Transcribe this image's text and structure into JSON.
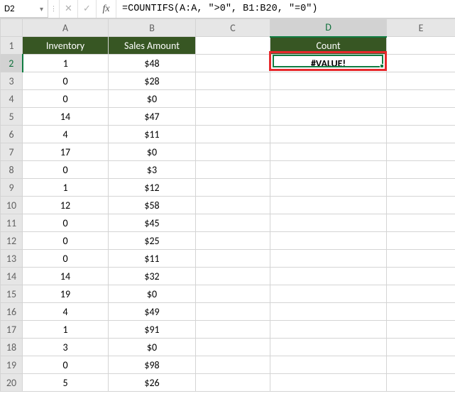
{
  "name_box": "D2",
  "formula": "=COUNTIFS(A:A, \">0\", B1:B20, \"=0\")",
  "fx_label": "fx",
  "columns": [
    "A",
    "B",
    "C",
    "D",
    "E"
  ],
  "headers": {
    "A": "Inventory",
    "B": "Sales Amount",
    "D": "Count"
  },
  "d2_value": "#VALUE!",
  "chart_data": {
    "type": "table",
    "columns": [
      "Inventory",
      "Sales Amount"
    ],
    "rows": [
      {
        "inv": 1,
        "sales": "$48"
      },
      {
        "inv": 0,
        "sales": "$28"
      },
      {
        "inv": 0,
        "sales": "$0"
      },
      {
        "inv": 14,
        "sales": "$47"
      },
      {
        "inv": 4,
        "sales": "$11"
      },
      {
        "inv": 17,
        "sales": "$0"
      },
      {
        "inv": 0,
        "sales": "$3"
      },
      {
        "inv": 1,
        "sales": "$12"
      },
      {
        "inv": 12,
        "sales": "$58"
      },
      {
        "inv": 0,
        "sales": "$45"
      },
      {
        "inv": 0,
        "sales": "$25"
      },
      {
        "inv": 0,
        "sales": "$11"
      },
      {
        "inv": 14,
        "sales": "$32"
      },
      {
        "inv": 19,
        "sales": "$0"
      },
      {
        "inv": 4,
        "sales": "$49"
      },
      {
        "inv": 1,
        "sales": "$91"
      },
      {
        "inv": 3,
        "sales": "$0"
      },
      {
        "inv": 0,
        "sales": "$98"
      },
      {
        "inv": 5,
        "sales": "$26"
      }
    ]
  },
  "row_numbers": [
    1,
    2,
    3,
    4,
    5,
    6,
    7,
    8,
    9,
    10,
    11,
    12,
    13,
    14,
    15,
    16,
    17,
    18,
    19,
    20
  ]
}
